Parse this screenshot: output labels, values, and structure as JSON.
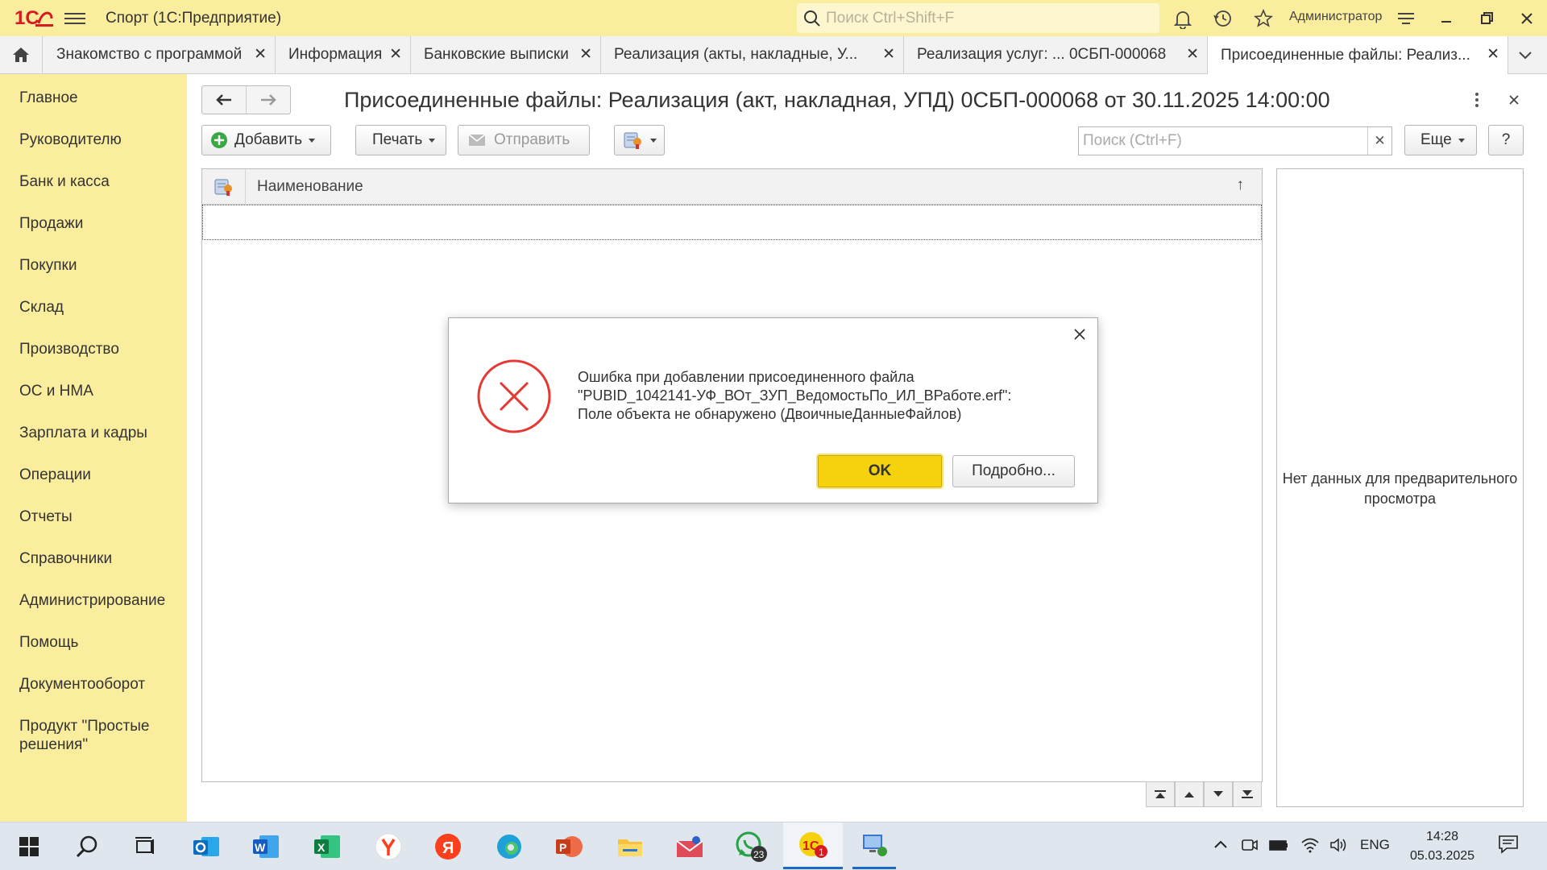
{
  "window": {
    "app_title": "Спорт  (1С:Предприятие)",
    "search_placeholder": "Поиск Ctrl+Shift+F",
    "user": "Администратор",
    "logo_text": "1С"
  },
  "tabs": [
    {
      "label": "Знакомство с программой"
    },
    {
      "label": "Информация"
    },
    {
      "label": "Банковские выписки"
    },
    {
      "label": "Реализация (акты, накладные, У..."
    },
    {
      "label": "Реализация услуг: ...  0СБП-000068"
    },
    {
      "label": "Присоединенные файлы: Реализ..."
    }
  ],
  "sidebar": {
    "items": [
      {
        "label": "Главное"
      },
      {
        "label": "Руководителю"
      },
      {
        "label": "Банк и касса"
      },
      {
        "label": "Продажи"
      },
      {
        "label": "Покупки"
      },
      {
        "label": "Склад"
      },
      {
        "label": "Производство"
      },
      {
        "label": "ОС и НМА"
      },
      {
        "label": "Зарплата и кадры"
      },
      {
        "label": "Операции"
      },
      {
        "label": "Отчеты"
      },
      {
        "label": "Справочники"
      },
      {
        "label": "Администрирование"
      },
      {
        "label": "Помощь"
      },
      {
        "label": "Документооборот"
      },
      {
        "label": "Продукт \"Простые решения\""
      }
    ]
  },
  "form": {
    "title": "Присоединенные файлы: Реализация (акт, накладная, УПД) 0СБП-000068 от 30.11.2025 14:00:00",
    "add_label": "Добавить",
    "print_label": "Печать",
    "send_label": "Отправить",
    "search_placeholder": "Поиск (Ctrl+F)",
    "more_label": "Еще",
    "help_label": "?",
    "column_name": "Наименование",
    "sort_arrow": "↑",
    "preview_message": "Нет данных для предварительного просмотра"
  },
  "dialog": {
    "line1": "Ошибка при добавлении присоединенного файла",
    "line2": "\"PUBID_1042141-УФ_ВОт_ЗУП_ВедомостьПо_ИЛ_ВРаботе.erf\":",
    "line3": "Поле объекта не обнаружено (ДвоичныеДанныеФайлов)",
    "ok_label": "OK",
    "details_label": "Подробно..."
  },
  "taskbar": {
    "whatsapp_badge": "23",
    "onec_badge": "1",
    "lang": "ENG",
    "time": "14:28",
    "date": "05.03.2025"
  },
  "colors": {
    "sidebar_bg": "#fbed9e",
    "accent_yellow": "#f5d20c",
    "error_red": "#e53935",
    "onec_red": "#d71920"
  }
}
